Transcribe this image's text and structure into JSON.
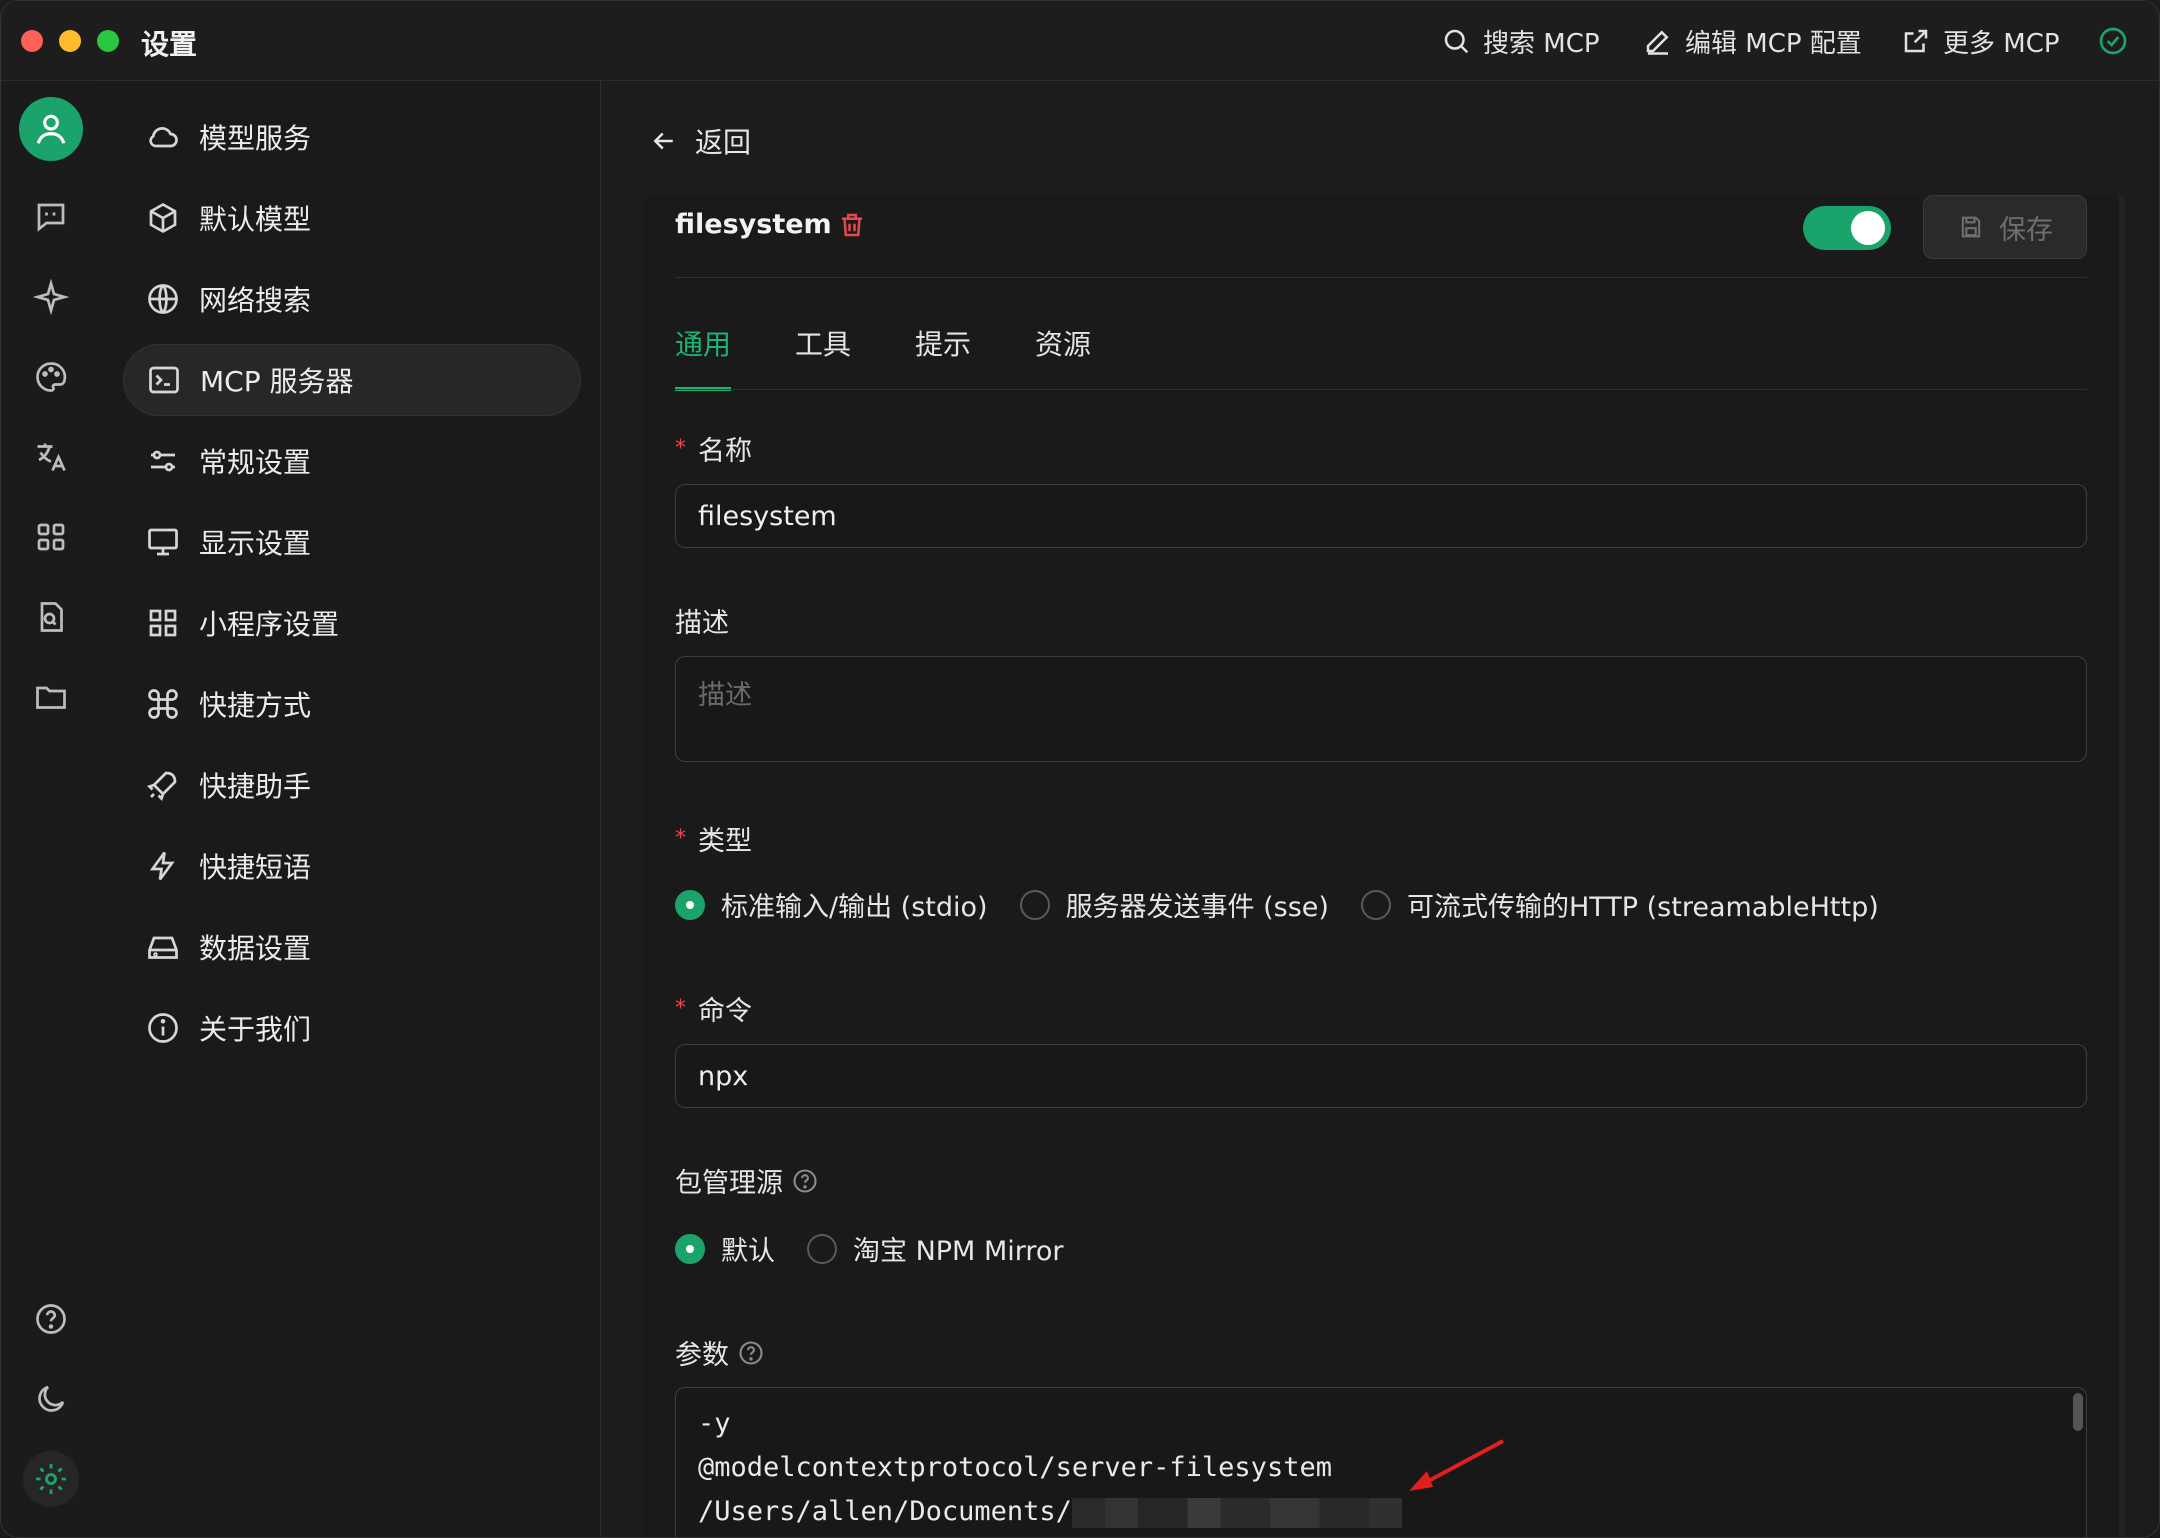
{
  "window": {
    "title": "设置"
  },
  "toolbar": {
    "search_mcp": "搜索 MCP",
    "edit_mcp_config": "编辑 MCP 配置",
    "more_mcp": "更多 MCP"
  },
  "rail": {
    "icons": [
      "user-avatar",
      "chat-icon",
      "sparkle-icon",
      "palette-icon",
      "translate-icon",
      "apps-grid-icon",
      "file-search-icon",
      "folder-icon"
    ],
    "bottom_icons": [
      "help-icon",
      "moon-icon",
      "settings-gear-icon"
    ]
  },
  "menu": {
    "items": [
      {
        "label": "模型服务",
        "icon": "cloud-icon"
      },
      {
        "label": "默认模型",
        "icon": "cube-icon"
      },
      {
        "label": "网络搜索",
        "icon": "globe-icon"
      },
      {
        "label": "MCP 服务器",
        "icon": "terminal-icon"
      },
      {
        "label": "常规设置",
        "icon": "sliders-icon"
      },
      {
        "label": "显示设置",
        "icon": "monitor-icon"
      },
      {
        "label": "小程序设置",
        "icon": "grid-icon"
      },
      {
        "label": "快捷方式",
        "icon": "command-icon"
      },
      {
        "label": "快捷助手",
        "icon": "rocket-icon"
      },
      {
        "label": "快捷短语",
        "icon": "bolt-icon"
      },
      {
        "label": "数据设置",
        "icon": "hard-drive-icon"
      },
      {
        "label": "关于我们",
        "icon": "info-icon"
      }
    ],
    "active_index": 3
  },
  "main": {
    "back_label": "返回",
    "server_name": "filesystem",
    "enabled": true,
    "save_label": "保存",
    "tabs": [
      "通用",
      "工具",
      "提示",
      "资源"
    ],
    "active_tab": 0,
    "form": {
      "name_label": "名称",
      "name_value": "filesystem",
      "desc_label": "描述",
      "desc_placeholder": "描述",
      "type_label": "类型",
      "type_options": [
        "标准输入/输出 (stdio)",
        "服务器发送事件 (sse)",
        "可流式传输的HTTP (streamableHttp)"
      ],
      "type_selected": 0,
      "command_label": "命令",
      "command_value": "npx",
      "registry_label": "包管理源",
      "registry_options": [
        "默认",
        "淘宝 NPM Mirror"
      ],
      "registry_selected": 0,
      "args_label": "参数",
      "args_lines": [
        "-y",
        "@modelcontextprotocol/server-filesystem",
        "/Users/allen/Documents/"
      ]
    }
  },
  "colors": {
    "accent": "#1aa36a",
    "danger": "#e5484d",
    "bg": "#1c1c1c"
  }
}
